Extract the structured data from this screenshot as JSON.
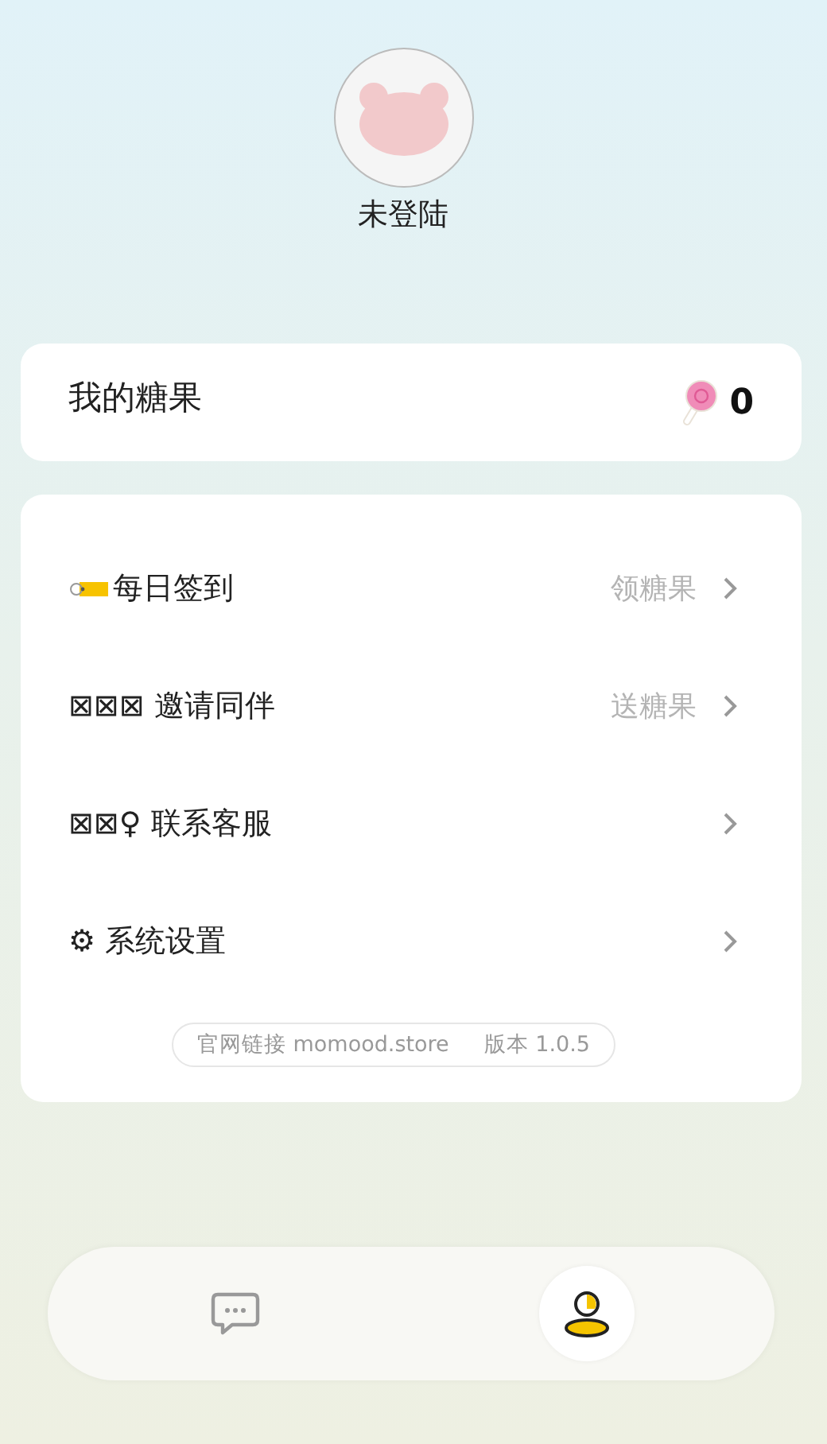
{
  "profile": {
    "name": "未登陆"
  },
  "candy": {
    "label": "我的糖果",
    "count": "0"
  },
  "menu": [
    {
      "kind": "tag",
      "label": "每日签到",
      "hint": "领糖果"
    },
    {
      "kind": "text",
      "label": "⊠⊠⊠ 邀请同伴",
      "hint": "送糖果"
    },
    {
      "kind": "text",
      "label": "⊠⊠♀ 联系客服"
    },
    {
      "kind": "text",
      "label": "⚙ 系统设置"
    }
  ],
  "footer": {
    "link": "官网链接 momood.store",
    "version": "版本 1.0.5"
  },
  "nav": [
    {
      "kind": "chat",
      "selected": false
    },
    {
      "kind": "person",
      "selected": true
    }
  ]
}
